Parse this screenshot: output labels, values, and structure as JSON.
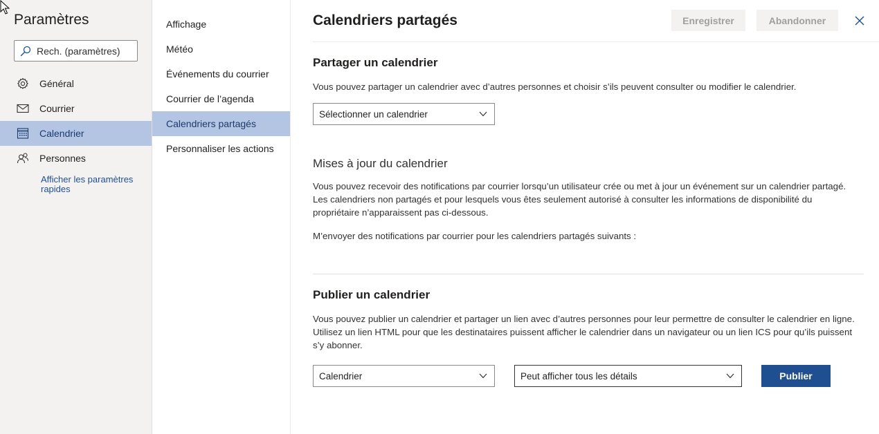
{
  "sidebar": {
    "title": "Paramètres",
    "search_placeholder": "Rech. (paramètres)",
    "items": [
      {
        "label": "Général",
        "icon": "gear-icon"
      },
      {
        "label": "Courrier",
        "icon": "mail-icon"
      },
      {
        "label": "Calendrier",
        "icon": "calendar-icon",
        "selected": true
      },
      {
        "label": "Personnes",
        "icon": "people-icon"
      }
    ],
    "quick_settings_link": "Afficher les paramètres rapides"
  },
  "subnav": {
    "items": [
      {
        "label": "Affichage"
      },
      {
        "label": "Météo"
      },
      {
        "label": "Événements du courrier"
      },
      {
        "label": "Courrier de l’agenda"
      },
      {
        "label": "Calendriers partagés",
        "selected": true
      },
      {
        "label": "Personnaliser les actions"
      }
    ]
  },
  "main": {
    "title": "Calendriers partagés",
    "save_label": "Enregistrer",
    "discard_label": "Abandonner",
    "share": {
      "title": "Partager un calendrier",
      "description": "Vous pouvez partager un calendrier avec d’autres personnes et choisir s’ils peuvent consulter ou modifier le calendrier.",
      "select_value": "Sélectionner un calendrier"
    },
    "updates": {
      "title": "Mises à jour du calendrier",
      "description": "Vous pouvez recevoir des notifications par courrier lorsqu’un utilisateur crée ou met à jour un événement sur un calendrier partagé. Les calendriers non partagés et pour lesquels vous êtes seulement autorisé à consulter les informations de disponibilité du propriétaire n’apparaissent pas ci-dessous.",
      "notify_label": "M’envoyer des notifications par courrier pour les calendriers partagés suivants :"
    },
    "publish": {
      "title": "Publier un calendrier",
      "description": "Vous pouvez publier un calendrier et partager un lien avec d’autres personnes pour leur permettre de consulter le calendrier en ligne. Utilisez un lien HTML pour que les destinataires puissent afficher le calendrier dans un navigateur ou un lien ICS pour qu’ils puissent s’y abonner.",
      "calendar_value": "Calendrier",
      "permission_value": "Peut afficher tous les détails",
      "publish_label": "Publier"
    }
  },
  "colors": {
    "accent": "#1f4e91",
    "selected_bg": "#b4c5e4",
    "sidebar_bg": "#f3f2f1"
  }
}
